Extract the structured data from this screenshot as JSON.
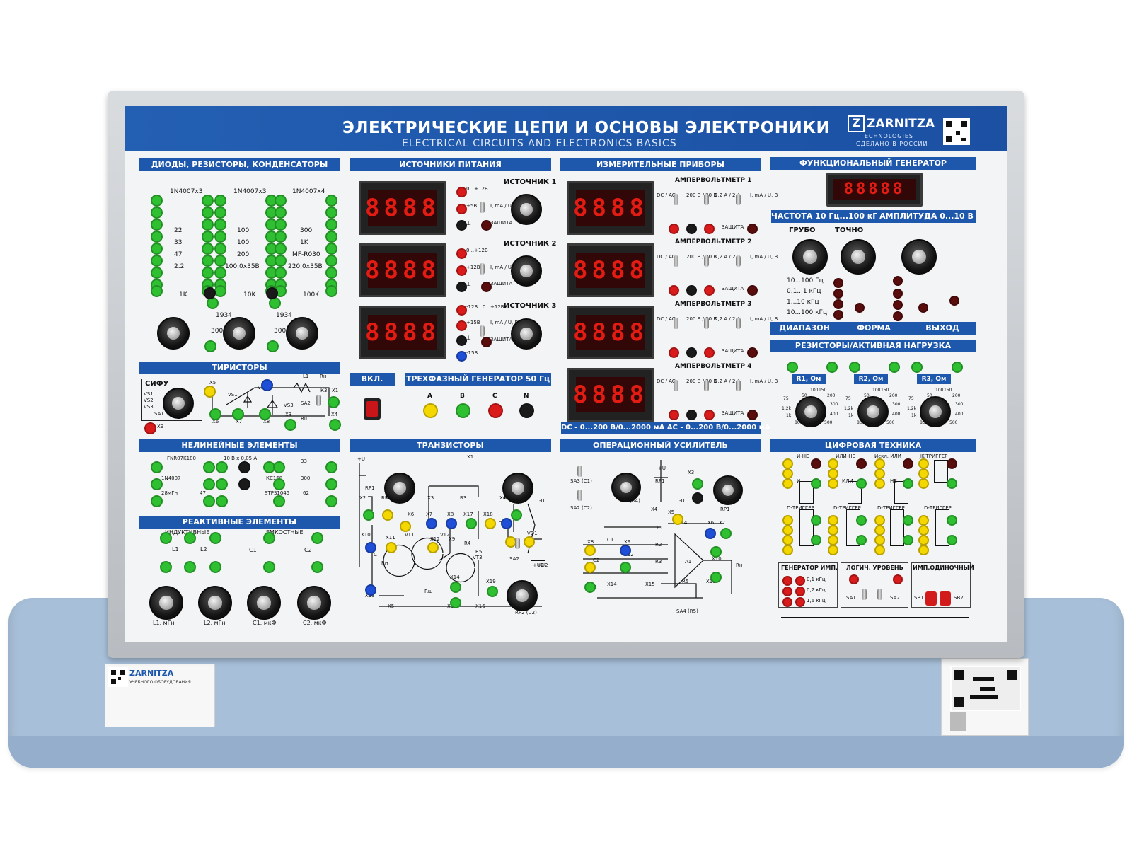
{
  "header": {
    "title_ru": "ЭЛЕКТРИЧЕСКИЕ ЦЕПИ И ОСНОВЫ ЭЛЕКТРОНИКИ",
    "title_en": "ELECTRICAL CIRCUITS AND ELECTRONICS BASICS",
    "brand": "ZARNITZA",
    "brand_sub": "TECHNOLOGIES",
    "made_in": "СДЕЛАНО В РОССИИ"
  },
  "sections": {
    "diodes": "ДИОДЫ, РЕЗИСТОРЫ, КОНДЕНСАТОРЫ",
    "thyristors": "ТИРИСТОРЫ",
    "nonlinear": "НЕЛИНЕЙНЫЕ ЭЛЕМЕНТЫ",
    "reactive": "РЕАКТИВНЫЕ ЭЛЕМЕНТЫ",
    "power": "ИСТОЧНИКИ ПИТАНИЯ",
    "on": "ВКЛ.",
    "threephase": "ТРЕХФАЗНЫЙ ГЕНЕРАТОР 50 Гц",
    "transistors": "ТРАНЗИСТОРЫ",
    "meters": "ИЗМЕРИТЕЛЬНЫЕ ПРИБОРЫ",
    "opamp": "ОПЕРАЦИОННЫЙ УСИЛИТЕЛЬ",
    "funcgen": "ФУНКЦИОНАЛЬНЫЙ ГЕНЕРАТОР",
    "resistors": "РЕЗИСТОРЫ/АКТИВНАЯ НАГРУЗКА",
    "digital": "ЦИФРОВАЯ ТЕХНИКА"
  },
  "diodes_panel": {
    "parts": [
      "1N4007x3",
      "1N4007x3",
      "1N4007x4",
      "22",
      "100",
      "300",
      "33",
      "100",
      "1K",
      "47",
      "200",
      "MF-R030",
      "2.2",
      "100,0x35В",
      "220,0x35В",
      "1K",
      "10K",
      "100K",
      "1934",
      "1934",
      "300",
      "300"
    ]
  },
  "thyristor_panel": {
    "labels": [
      "СИФУ",
      "VS1",
      "VS2",
      "VS3",
      "SA1",
      "X5",
      "X6",
      "X7",
      "X8",
      "X9",
      "X1",
      "X3",
      "X4",
      "К3",
      "L1",
      "Rн",
      "SA2",
      "Rш",
      "VS1",
      "VS2",
      "VS3"
    ]
  },
  "nonlinear_panel": {
    "labels": [
      "FNR07K180",
      "10 В x 0,05 А",
      "33",
      "1N4007",
      "КС168",
      "300",
      "28мГн",
      "47",
      "STPS1045",
      "62"
    ]
  },
  "reactive_panel": {
    "labels": [
      "ИНДУКТИВНЫЕ",
      "ЕМКОСТНЫЕ",
      "L1",
      "L2",
      "C1",
      "C2",
      "L1, мГн",
      "L2, мГн",
      "C1, мкФ",
      "C2, мкФ"
    ]
  },
  "power": {
    "display": "8888",
    "sources": [
      {
        "name": "ИСТОЧНИК 1",
        "r1": "0...+12В",
        "r2": "+5В",
        "r3": "⊥",
        "unit": "I, mA / U, В",
        "prot": "ЗАЩИТА"
      },
      {
        "name": "ИСТОЧНИК 2",
        "r1": "0...+12В",
        "r2": "+12В",
        "r3": "⊥",
        "unit": "I, mA / U, В",
        "prot": "ЗАЩИТА"
      },
      {
        "name": "ИСТОЧНИК 3",
        "r1": "-12В...0...+12В",
        "r2": "+15В",
        "r3": "⊥",
        "r4": "-15В",
        "unit": "I, mA / U, В",
        "prot": "ЗАЩИТА"
      }
    ],
    "phases": [
      "A",
      "B",
      "C",
      "N"
    ]
  },
  "meters": {
    "display": "8888",
    "items": [
      {
        "name": "АМПЕРВОЛЬТМЕТР 1"
      },
      {
        "name": "АМПЕРВОЛЬТМЕТР 2"
      },
      {
        "name": "АМПЕРВОЛЬТМЕТР 3"
      },
      {
        "name": "АМПЕРВОЛЬТМЕТР 4"
      }
    ],
    "dcac": "DC / AC",
    "range1": "200 В / 20 В",
    "range2": "0,2 А / 2 А",
    "range3": "I, mA / U, В",
    "jacks": "U   ⊥   I",
    "prot": "ЗАЩИТА",
    "footer": "DC - 0...200 В/0...2000 мА   AC - 0...200 В/0...2000 мА"
  },
  "transistor_panel": {
    "labels": [
      "+U",
      "X1",
      "X2",
      "X3",
      "X4",
      "X5",
      "X6",
      "X7",
      "X8",
      "X9",
      "X10",
      "X11",
      "X12",
      "X13",
      "X14",
      "X15",
      "X16",
      "X17",
      "X18",
      "X19",
      "RP1",
      "RP2",
      "R1",
      "R2",
      "R3",
      "R4",
      "R5",
      "Rш",
      "Rн",
      "VT1",
      "VT2",
      "VT3",
      "VD1",
      "SA2",
      "+U2",
      "-U",
      "C",
      "RP1",
      "RP2 (U2)"
    ]
  },
  "opamp_panel": {
    "labels": [
      "SA3 (C1)",
      "SA2 (C2)",
      "SA1 (R4)",
      "RP1",
      "+U",
      "-U",
      "X3",
      "X4",
      "X5",
      "X6",
      "X7",
      "X8",
      "X9",
      "X10",
      "X11",
      "X12",
      "X13",
      "X14",
      "X15",
      "C1",
      "C2",
      "R1",
      "R2",
      "R3",
      "R4",
      "R5",
      "A1",
      "Rн",
      "SA4 (R5)",
      "RP1"
    ]
  },
  "funcgen": {
    "display": "88888",
    "freq": "ЧАСТОТА 10 Гц...100 кГц",
    "amp": "АМПЛИТУДА 0...10 В",
    "coarse": "ГРУБО",
    "fine": "ТОЧНО",
    "ranges": [
      "10...100 Гц",
      "0.1...1 кГц",
      "1...10 кГц",
      "10...100 кГц"
    ],
    "bottom": [
      "ДИАПАЗОН",
      "ФОРМА",
      "ВЫХОД"
    ]
  },
  "resistors_panel": {
    "items": [
      "R1, Ом",
      "R2, Ом",
      "R3, Ом"
    ],
    "scale": [
      "50",
      "100",
      "150",
      "200",
      "300",
      "400",
      "500",
      "600",
      "800",
      "1k",
      "1,2k",
      "75"
    ]
  },
  "digital": {
    "gates": [
      "И-НЕ",
      "ИЛИ-НЕ",
      "Искл. ИЛИ",
      "JK-ТРИГГЕР",
      "И",
      "ИЛИ",
      "НЕ",
      "D-ТРИГГЕР",
      "D-ТРИГГЕР",
      "D-ТРИГГЕР",
      "D-ТРИГГЕР"
    ],
    "gen": "ГЕНЕРАТОР ИМП.",
    "gen_freqs": [
      "0,1 кГц",
      "0,2 кГц",
      "1,6 кГц"
    ],
    "logic": "ЛОГИЧ. УРОВЕНЬ",
    "single": "ИМП.ОДИНОЧНЫЙ",
    "sa": [
      "SA1",
      "SA2"
    ],
    "sb": [
      "SB1",
      "SB2"
    ]
  },
  "stickers": {
    "left_brand": "ZARNITZA",
    "left_tag": "УЧЕБНОГО ОБОРУДОВАНИЯ"
  }
}
